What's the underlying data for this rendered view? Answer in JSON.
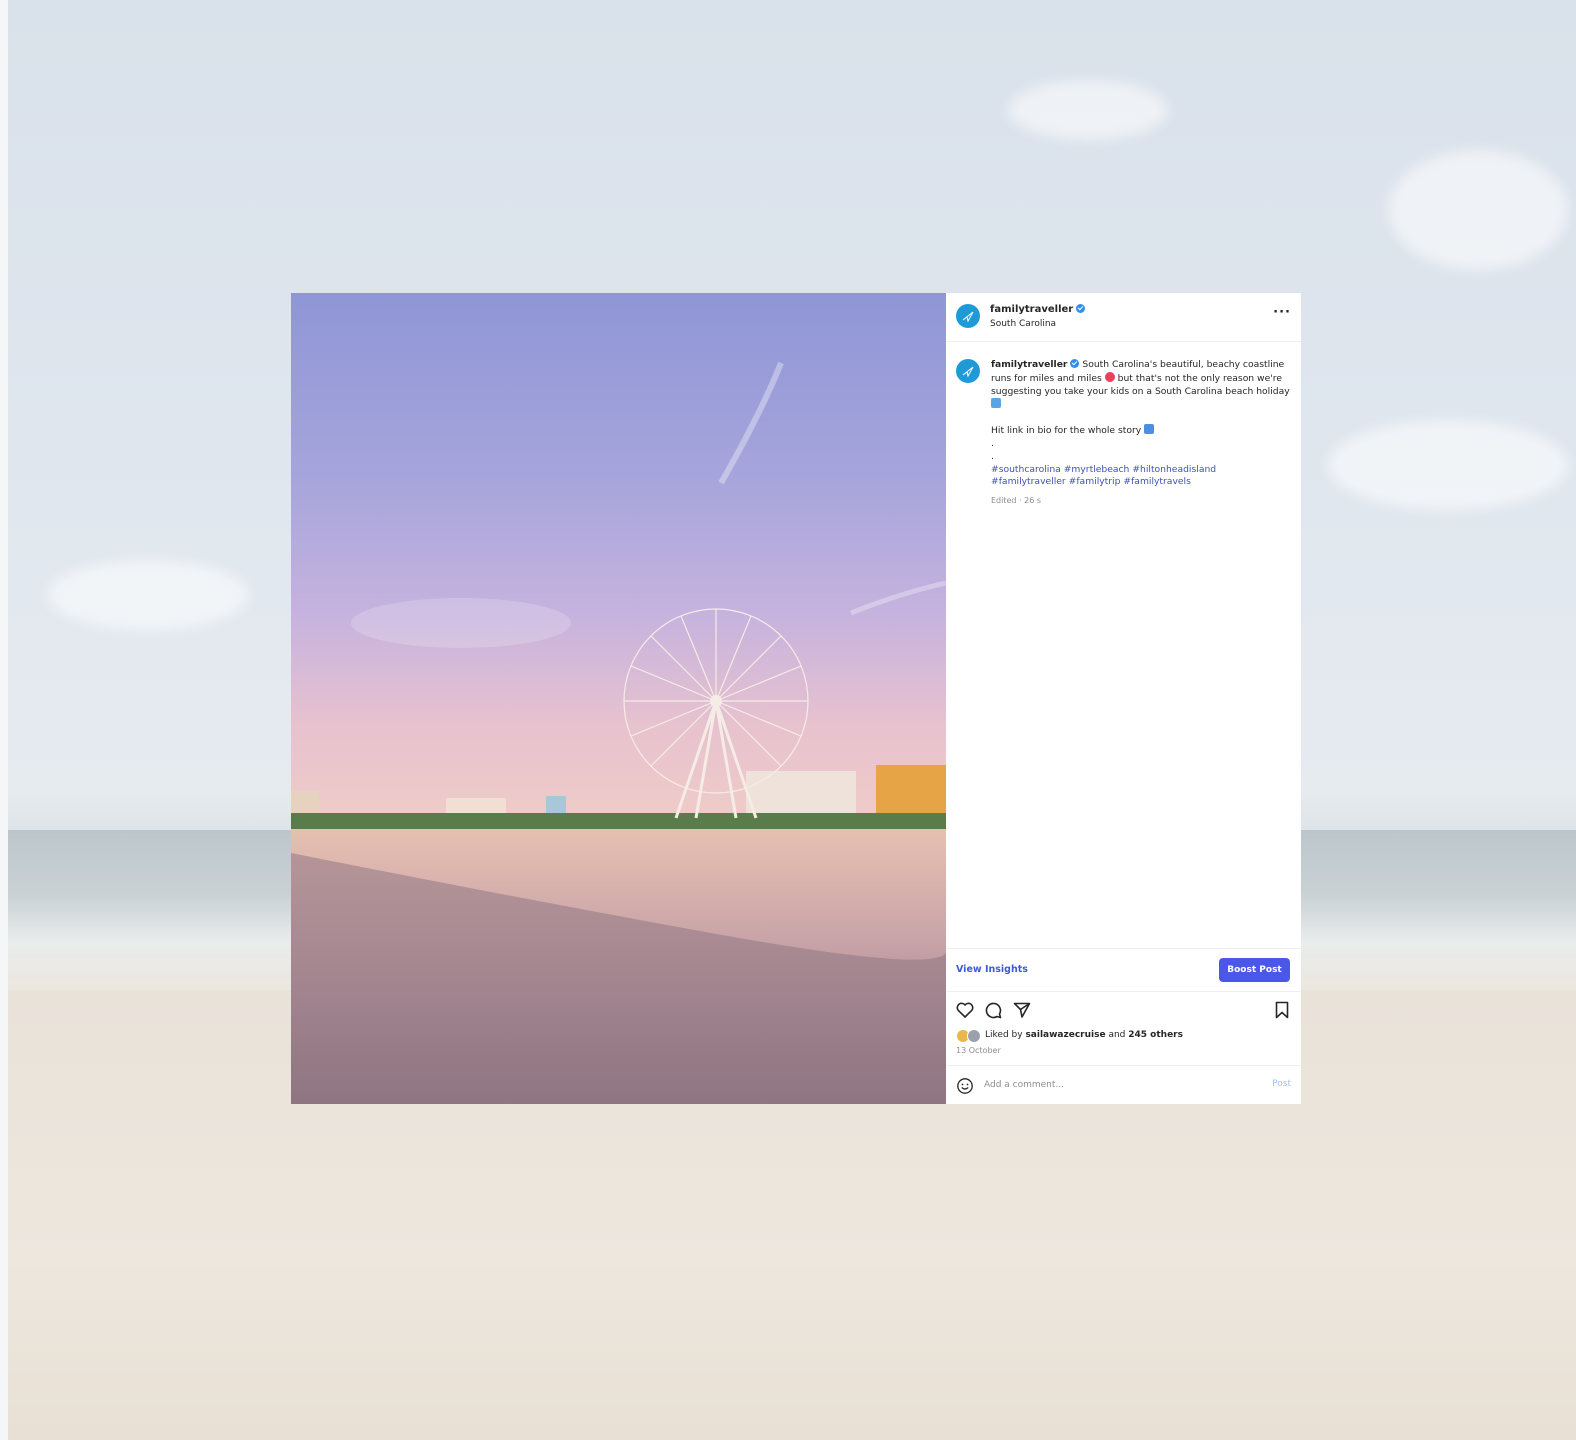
{
  "post": {
    "username": "familytraveller",
    "location": "South Carolina",
    "caption_text": "South Carolina's beautiful, beachy coastline runs for miles and miles",
    "caption_text_2": "but that's not the only reason we're suggesting you take your kids on a South Carolina beach holiday",
    "link_line": "Hit link in bio for the whole story",
    "dot_1": ".",
    "dot_2": ".",
    "hashtags": [
      "#southcarolina",
      "#myrtlebeach",
      "#hiltonheadisland",
      "#familytraveller",
      "#familytrip",
      "#familytravels"
    ],
    "edited": "Edited · 26 s",
    "more_icon": "more-horizontal-icon"
  },
  "insights": {
    "view_label": "View Insights",
    "boost_label": "Boost Post"
  },
  "actions": {
    "icons": [
      "heart-icon",
      "comment-icon",
      "share-icon",
      "bookmark-icon"
    ]
  },
  "likes": {
    "prefix": "Liked by",
    "user": "sailawazecruise",
    "and": "and",
    "others": "245 others",
    "date": "13 October"
  },
  "comment": {
    "placeholder": "Add a comment...",
    "post_label": "Post"
  },
  "colors": {
    "accent": "#4b57e8",
    "link": "#3b5bdb",
    "hashtag": "#3f51b5",
    "avatar": "#1e9bd7",
    "verified": "#2f8ff0"
  }
}
